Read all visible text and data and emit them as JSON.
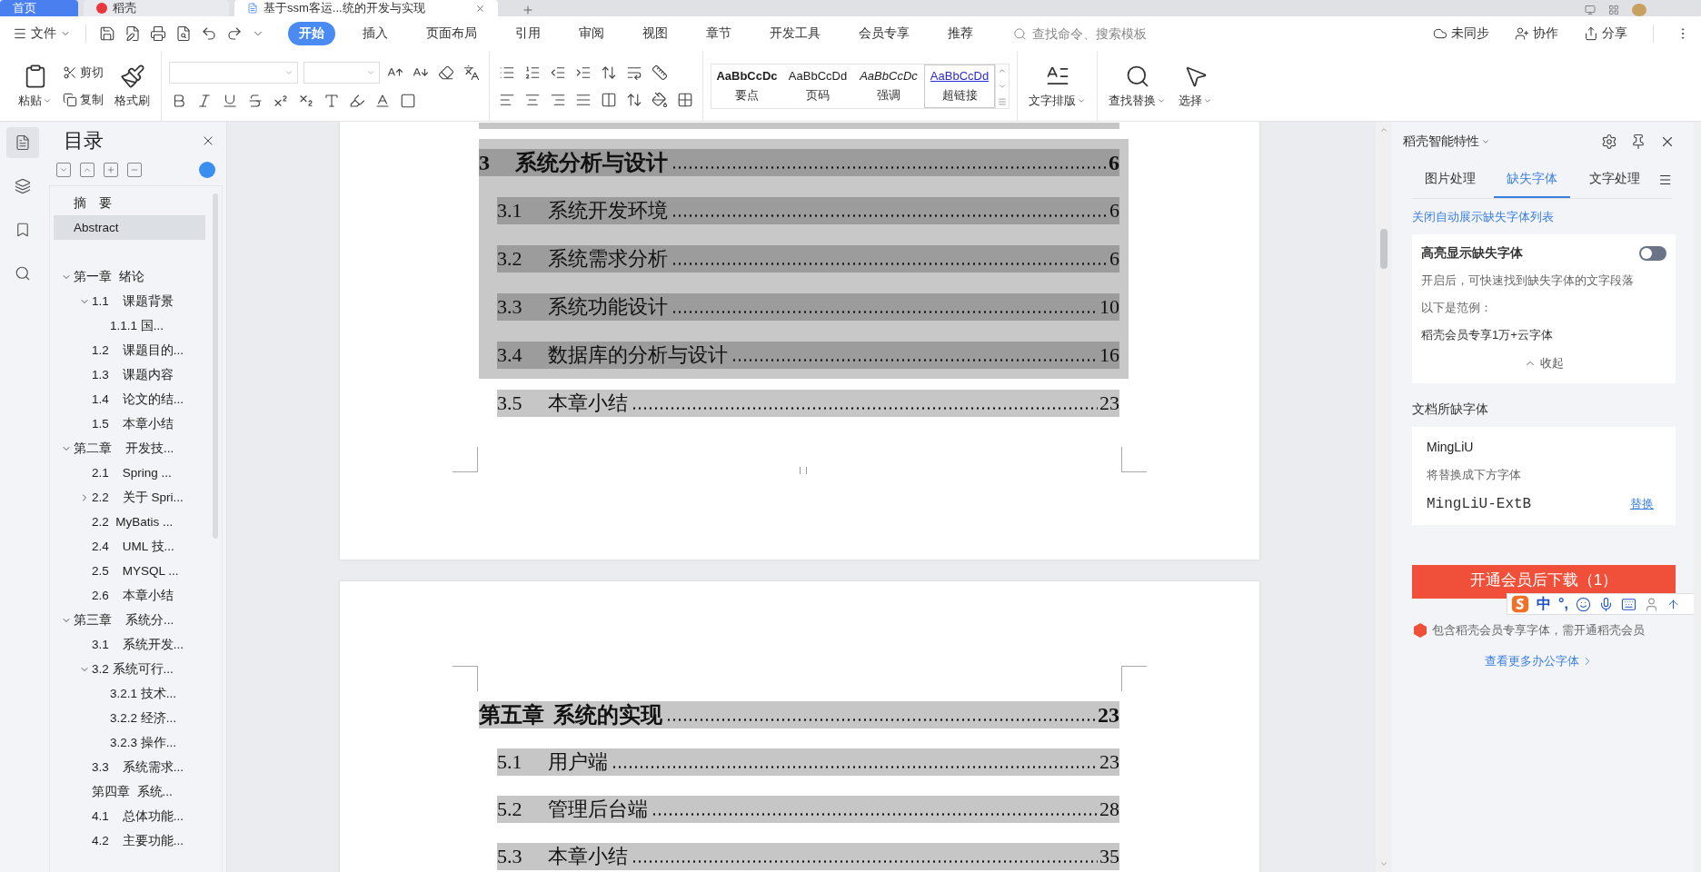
{
  "tabs": [
    {
      "label": "首页",
      "selected": false,
      "kind": "home"
    },
    {
      "label": "稻壳",
      "selected": false,
      "kind": "docer"
    },
    {
      "label": "基于ssm客运...统的开发与实现",
      "selected": true,
      "kind": "doc"
    }
  ],
  "menu": {
    "file": "文件",
    "items": [
      {
        "label": "开始",
        "selected": true
      },
      {
        "label": "插入",
        "selected": false
      },
      {
        "label": "页面布局",
        "selected": false
      },
      {
        "label": "引用",
        "selected": false
      },
      {
        "label": "审阅",
        "selected": false
      },
      {
        "label": "视图",
        "selected": false
      },
      {
        "label": "章节",
        "selected": false
      },
      {
        "label": "开发工具",
        "selected": false
      },
      {
        "label": "会员专享",
        "selected": false
      },
      {
        "label": "推荐",
        "selected": false
      }
    ],
    "search": {
      "placeholder": "查找命令、搜索模板"
    },
    "actions": [
      "未同步",
      "协作",
      "分享"
    ]
  },
  "ribbon": {
    "paste": "粘贴",
    "cut": "剪切",
    "copy": "复制",
    "format_painter": "格式刷",
    "styles": [
      {
        "preview": "AaBbCcDc",
        "label": "要点",
        "kind": "bold",
        "selected": false
      },
      {
        "preview": "AaBbCcDd",
        "label": "页码",
        "kind": "plain",
        "selected": false
      },
      {
        "preview": "AaBbCcDc",
        "label": "强调",
        "kind": "italic",
        "selected": false
      },
      {
        "preview": "AaBbCcDd",
        "label": "超链接",
        "kind": "link",
        "selected": true
      }
    ],
    "text_layout": "文字排版",
    "find_replace": "查找替换",
    "select": "选择"
  },
  "toc_panel": {
    "title": "目录",
    "items": [
      {
        "label": "摘　要",
        "selected": false
      },
      {
        "label": "Abstract",
        "selected": true
      },
      {
        "label": "第一章  绪论",
        "selected": false,
        "expanded": true,
        "children": [
          {
            "label": "1.1    课题背景",
            "selected": false,
            "expanded": true,
            "children": [
              {
                "label": "1.1.1 国...",
                "selected": false
              }
            ]
          },
          {
            "label": "1.2    课题目的...",
            "selected": false
          },
          {
            "label": "1.3    课题内容",
            "selected": false
          },
          {
            "label": "1.4    论文的结...",
            "selected": false
          },
          {
            "label": "1.5    本章小结",
            "selected": false
          }
        ]
      },
      {
        "label": "第二章    开发技...",
        "selected": false,
        "expanded": true,
        "children": [
          {
            "label": "2.1    Spring ...",
            "selected": false
          },
          {
            "label": "2.2    关于 Spri...",
            "selected": false,
            "expanded": false
          },
          {
            "label": "2.2  MyBatis ...",
            "selected": false
          },
          {
            "label": "2.4    UML 技...",
            "selected": false
          },
          {
            "label": "2.5    MYSQL ...",
            "selected": false
          },
          {
            "label": "2.6    本章小结",
            "selected": false
          }
        ]
      },
      {
        "label": "第三章    系统分...",
        "selected": false,
        "expanded": true,
        "children": [
          {
            "label": "3.1    系统开发...",
            "selected": false
          },
          {
            "label": "3.2 系统可行...",
            "selected": false,
            "expanded": true,
            "children": [
              {
                "label": "3.2.1 技术...",
                "selected": false
              },
              {
                "label": "3.2.2 经济...",
                "selected": false
              },
              {
                "label": "3.2.3 操作...",
                "selected": false
              }
            ]
          },
          {
            "label": "3.3    系统需求...",
            "selected": false
          },
          {
            "label": "第四章  系统...",
            "selected": false
          },
          {
            "label": "4.1    总体功能...",
            "selected": false
          },
          {
            "label": "4.2    主要功能...",
            "selected": false
          }
        ]
      }
    ]
  },
  "pages": [
    {
      "kind": "top",
      "groups": [
        {
          "kind": "block",
          "entries": [
            {
              "kind": "chapter",
              "number": "3",
              "title": "系统分析与设计",
              "page": "6"
            },
            {
              "kind": "section",
              "number": "3.1",
              "title": "系统开发环境",
              "page": "6"
            },
            {
              "kind": "section",
              "number": "3.2",
              "title": "系统需求分析",
              "page": "6"
            },
            {
              "kind": "section",
              "number": "3.3",
              "title": "系统功能设计",
              "page": "10"
            },
            {
              "kind": "section",
              "number": "3.4",
              "title": "数据库的分析与设计",
              "page": "16"
            }
          ]
        },
        {
          "kind": "plain",
          "entries": [
            {
              "kind": "section",
              "number": "3.5",
              "title": "本章小结",
              "page": "23"
            }
          ]
        }
      ]
    },
    {
      "kind": "next",
      "groups": [
        {
          "kind": "plain",
          "entries": [
            {
              "kind": "chapter",
              "number": "第五章",
              "title": "系统的实现",
              "page": "23"
            },
            {
              "kind": "section",
              "number": "5.1",
              "title": "用户端",
              "page": "23"
            },
            {
              "kind": "section",
              "number": "5.2",
              "title": "管理后台端",
              "page": "28"
            },
            {
              "kind": "section",
              "number": "5.3",
              "title": "本章小结",
              "page": "35"
            }
          ]
        }
      ]
    }
  ],
  "side_panel": {
    "title": "稻壳智能特性",
    "tabs": [
      {
        "label": "图片处理",
        "selected": false
      },
      {
        "label": "缺失字体",
        "selected": true
      },
      {
        "label": "文字处理",
        "selected": false
      }
    ],
    "close_link": "关闭自动展示缺失字体列表",
    "highlight": {
      "title": "高亮显示缺失字体",
      "on": false,
      "description": "开启后，可快速找到缺失字体的文字段落",
      "example_label": "以下是范例：",
      "example": "稻壳会员专享1万+云字体",
      "collapse": "收起"
    },
    "missing_heading": "文档所缺字体",
    "missing_font": {
      "name": "MingLiU",
      "hint": "将替换成下方字体",
      "replacement": "MingLiU-ExtB",
      "action": "替换"
    },
    "download_button": "开通会员后下载（1）",
    "note": "包含稻壳会员专享字体，需开通稻壳会员",
    "more_link": "查看更多办公字体"
  },
  "ime_bar": {
    "mode": "中",
    "punct": "°,"
  }
}
